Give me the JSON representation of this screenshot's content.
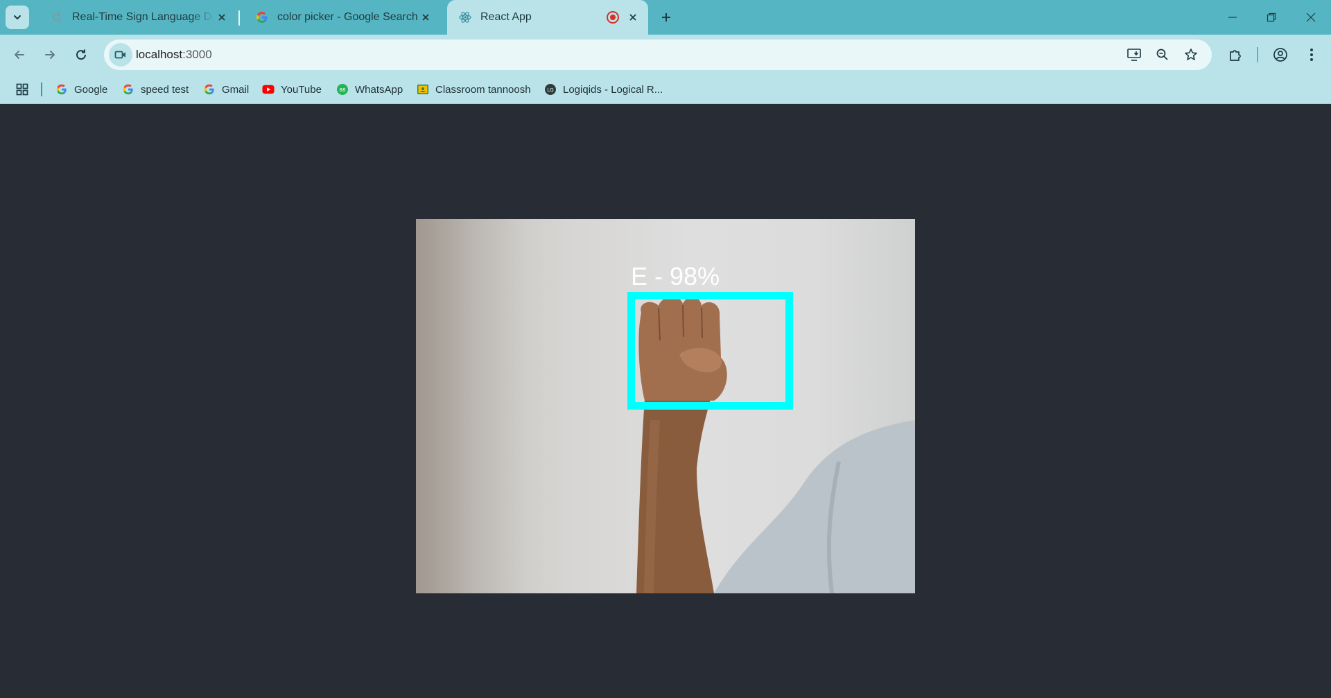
{
  "tabs": [
    {
      "title": "Real-Time Sign Language Detec",
      "active": false,
      "favicon": "reload-favicon-icon"
    },
    {
      "title": "color picker - Google Search",
      "active": false,
      "favicon": "google-g-icon"
    },
    {
      "title": "React App",
      "active": true,
      "favicon": "react-atom-icon",
      "recording": true
    }
  ],
  "address_bar": {
    "host": "localhost",
    "port": ":3000"
  },
  "bookmarks": [
    {
      "label": "Google",
      "icon": "google-g-icon"
    },
    {
      "label": "speed test",
      "icon": "google-g-icon"
    },
    {
      "label": "Gmail",
      "icon": "google-g-icon"
    },
    {
      "label": "YouTube",
      "icon": "youtube-icon"
    },
    {
      "label": "WhatsApp",
      "icon": "whatsapp-icon"
    },
    {
      "label": "Classroom tannoosh",
      "icon": "classroom-icon"
    },
    {
      "label": "Logiqids - Logical R...",
      "icon": "logiqids-icon"
    }
  ],
  "detection": {
    "label": "E - 98%",
    "box_color": "#00ffff"
  },
  "colors": {
    "tabstrip": "#56b5c2",
    "toolbar": "#b9e3e9",
    "page_bg": "#282c34"
  }
}
